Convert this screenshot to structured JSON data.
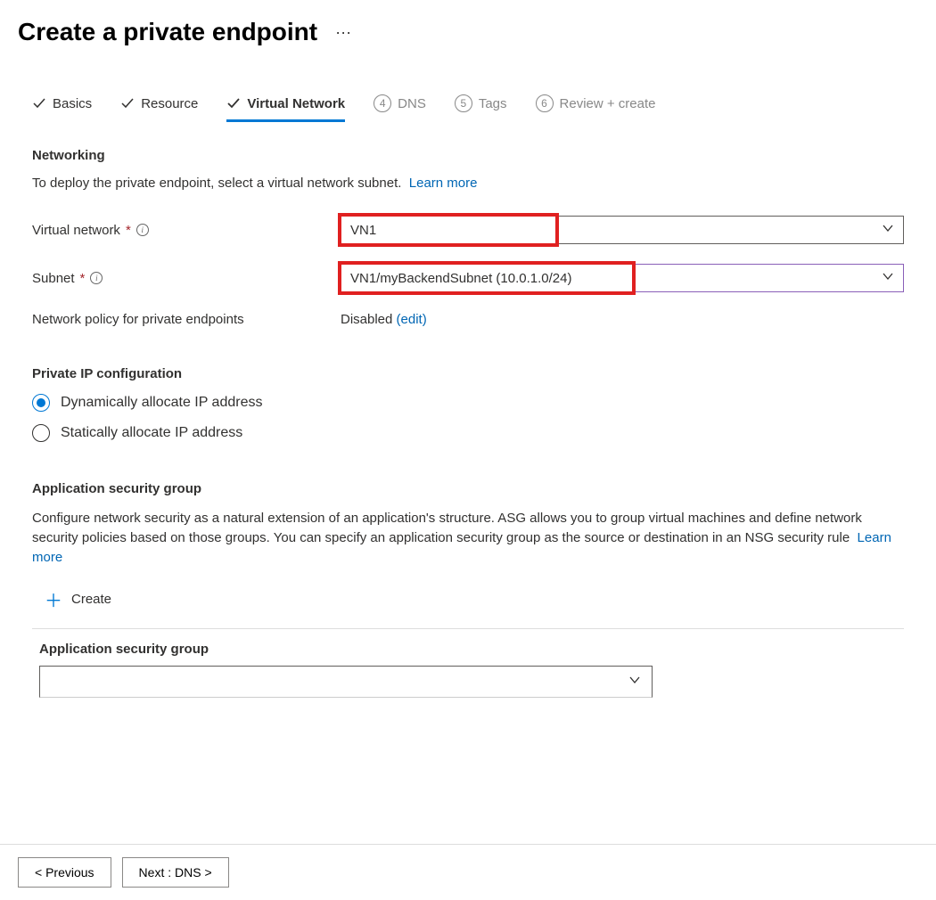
{
  "header": {
    "title": "Create a private endpoint"
  },
  "tabs": [
    {
      "label": "Basics",
      "state": "done"
    },
    {
      "label": "Resource",
      "state": "done"
    },
    {
      "label": "Virtual Network",
      "state": "active"
    },
    {
      "label": "DNS",
      "state": "pending",
      "num": "4"
    },
    {
      "label": "Tags",
      "state": "pending",
      "num": "5"
    },
    {
      "label": "Review + create",
      "state": "pending",
      "num": "6"
    }
  ],
  "networking": {
    "heading": "Networking",
    "helper": "To deploy the private endpoint, select a virtual network subnet.",
    "learn_more": "Learn more",
    "vnet_label": "Virtual network",
    "vnet_value": "VN1",
    "subnet_label": "Subnet",
    "subnet_value": "VN1/myBackendSubnet (10.0.1.0/24)",
    "policy_label": "Network policy for private endpoints",
    "policy_value": "Disabled",
    "policy_edit": "(edit)"
  },
  "private_ip": {
    "heading": "Private IP configuration",
    "options": [
      {
        "label": "Dynamically allocate IP address",
        "selected": true
      },
      {
        "label": "Statically allocate IP address",
        "selected": false
      }
    ]
  },
  "asg": {
    "heading": "Application security group",
    "text": "Configure network security as a natural extension of an application's structure. ASG allows you to group virtual machines and define network security policies based on those groups. You can specify an application security group as the source or destination in an NSG security rule",
    "learn_more": "Learn more",
    "create_label": "Create",
    "column_label": "Application security group"
  },
  "footer": {
    "prev": "< Previous",
    "next": "Next : DNS >"
  }
}
